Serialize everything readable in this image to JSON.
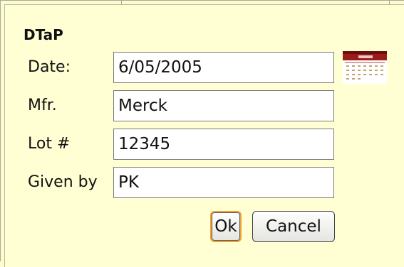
{
  "dialog": {
    "title": "DTaP"
  },
  "fields": {
    "date": {
      "label": "Date:",
      "value": "6/05/2005"
    },
    "mfr": {
      "label": "Mfr.",
      "value": "Merck"
    },
    "lot": {
      "label": "Lot #",
      "value": "12345"
    },
    "given_by": {
      "label": "Given by",
      "value": "PK"
    }
  },
  "buttons": {
    "ok": "Ok",
    "cancel": "Cancel"
  },
  "icons": {
    "date_picker": "calendar-icon"
  },
  "colors": {
    "dialog_background": "#ffffd3",
    "ok_focus_border": "#f0a030",
    "calendar_header": "#9b1b1b"
  }
}
